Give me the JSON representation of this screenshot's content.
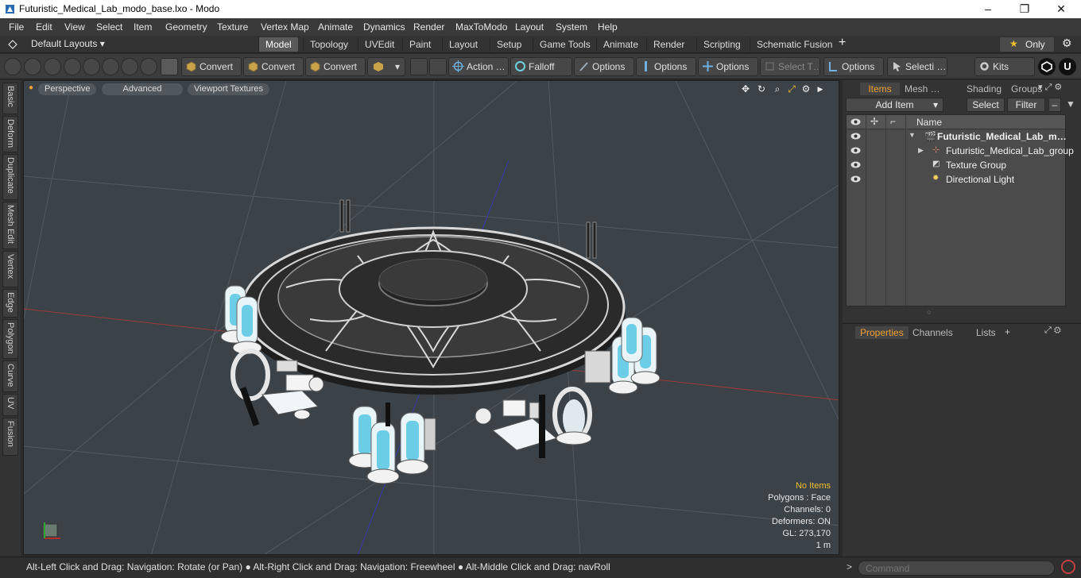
{
  "window": {
    "title": "Futuristic_Medical_Lab_modo_base.lxo - Modo",
    "minimize": "–",
    "maximize": "❐",
    "close": "✕"
  },
  "menu": [
    "File",
    "Edit",
    "View",
    "Select",
    "Item",
    "Geometry",
    "Texture",
    "Vertex Map",
    "Animate",
    "Dynamics",
    "Render",
    "MaxToModo",
    "Layout",
    "System",
    "Help"
  ],
  "layoutbar": {
    "layouts_label": "Default Layouts",
    "tabs": [
      "Model",
      "Topology",
      "UVEdit",
      "Paint",
      "Layout",
      "Setup",
      "Game Tools",
      "Animate",
      "Render",
      "Scripting",
      "Schematic Fusion"
    ],
    "active_tab": "Model",
    "add": "+",
    "only_label": "Only"
  },
  "toolbar": {
    "convert1": "Convert",
    "convert2": "Convert",
    "convert3": "Convert",
    "action": "Action …",
    "falloff": "Falloff",
    "options1": "Options",
    "options2": "Options",
    "options3": "Options",
    "select_t": "Select T…",
    "options4": "Options",
    "selecti": "Selecti …",
    "kits": "Kits"
  },
  "left_tabs": [
    "Basic",
    "Deform",
    "Duplicate",
    "Mesh Edit",
    "Vertex",
    "Edge",
    "Polygon",
    "Curve",
    "UV",
    "Fusion"
  ],
  "viewport": {
    "tabs": [
      "Perspective",
      "Advanced",
      "Viewport Textures"
    ],
    "hud": {
      "no_items": "No Items",
      "polygons": "Polygons : Face",
      "channels": "Channels: 0",
      "deformers": "Deformers: ON",
      "gl": "GL: 273,170",
      "scale": "1 m"
    }
  },
  "items_panel": {
    "tabs": [
      "Items",
      "Mesh …",
      "Shading",
      "Groups"
    ],
    "add_item": "Add Item",
    "select": "Select",
    "filter": "Filter",
    "column_name": "Name",
    "rows": [
      {
        "name": "Futuristic_Medical_Lab_m…",
        "type": "scene"
      },
      {
        "name": "Futuristic_Medical_Lab_group",
        "type": "group"
      },
      {
        "name": "Texture Group",
        "type": "texture"
      },
      {
        "name": "Directional Light",
        "type": "light"
      }
    ]
  },
  "properties_panel": {
    "tabs": [
      "Properties",
      "Channels",
      "Lists"
    ],
    "add": "+"
  },
  "statusbar": {
    "text": "Alt-Left Click and Drag: Navigation: Rotate (or Pan) ● Alt-Right Click and Drag: Navigation: Freewheel ● Alt-Middle Click and Drag: navRoll",
    "command_placeholder": "Command"
  },
  "colors": {
    "accent": "#f0a030",
    "viewport_bg": "#3b4248",
    "panel_bg": "#333333",
    "x_axis": "#b04040",
    "z_axis": "#4040c0"
  }
}
